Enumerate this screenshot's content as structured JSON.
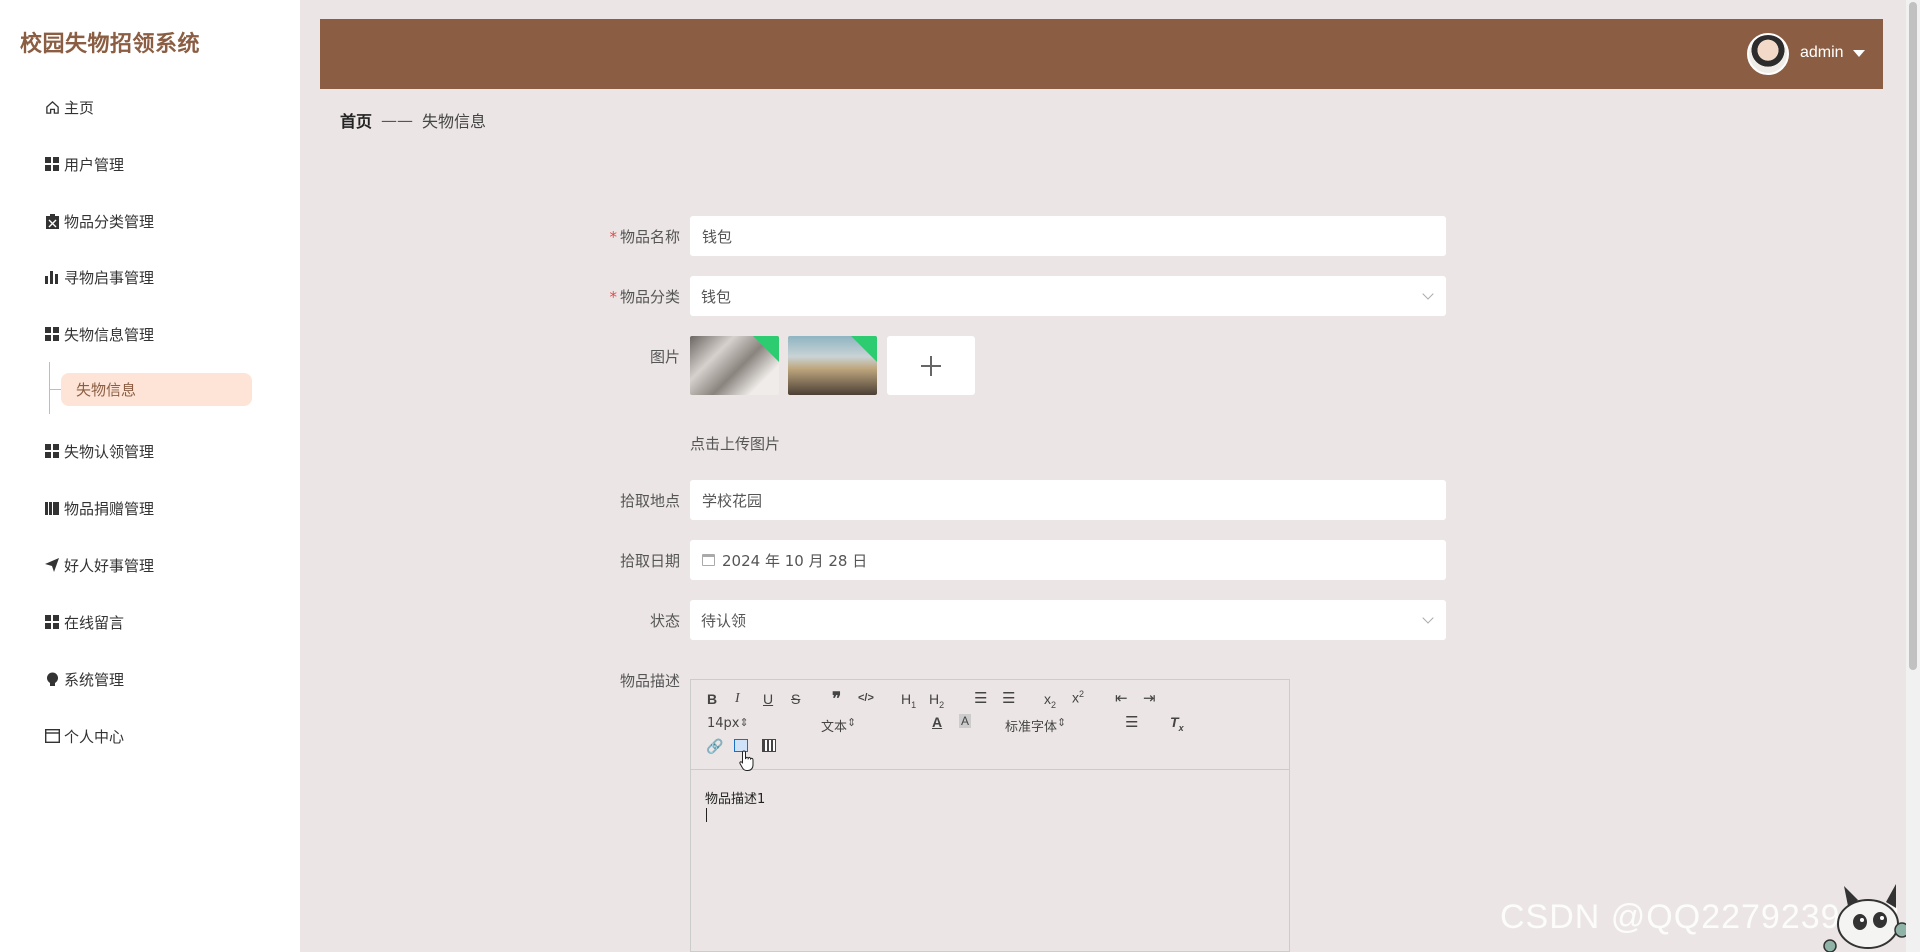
{
  "app_title": "校园失物招领系统",
  "menu": {
    "items": [
      {
        "label": "主页",
        "icon": "home-icon"
      },
      {
        "label": "用户管理",
        "icon": "grid-icon"
      },
      {
        "label": "物品分类管理",
        "icon": "clipboard-icon"
      },
      {
        "label": "寻物启事管理",
        "icon": "bar-chart-icon"
      },
      {
        "label": "失物信息管理",
        "icon": "grid-icon"
      },
      {
        "label": "失物认领管理",
        "icon": "grid-icon"
      },
      {
        "label": "物品捐赠管理",
        "icon": "book-icon"
      },
      {
        "label": "好人好事管理",
        "icon": "send-icon"
      },
      {
        "label": "在线留言",
        "icon": "grid-icon"
      },
      {
        "label": "系统管理",
        "icon": "bulb-icon"
      },
      {
        "label": "个人中心",
        "icon": "window-icon"
      }
    ],
    "active_sub_item": "失物信息"
  },
  "header": {
    "username": "admin"
  },
  "breadcrumb": {
    "home": "首页",
    "separator": "——",
    "current": "失物信息"
  },
  "form": {
    "item_name": {
      "label": "物品名称",
      "required": true,
      "value": "钱包"
    },
    "category": {
      "label": "物品分类",
      "required": true,
      "value": "钱包"
    },
    "images": {
      "label": "图片",
      "upload_hint": "点击上传图片",
      "count": 2
    },
    "location": {
      "label": "拾取地点",
      "value": "学校花园"
    },
    "date": {
      "label": "拾取日期",
      "value": "2024 年 10 月 28 日"
    },
    "status": {
      "label": "状态",
      "value": "待认领"
    },
    "description": {
      "label": "物品描述",
      "content": "物品描述1",
      "toolbar": {
        "font_size": "14px",
        "block_type": "文本",
        "font_family": "标准字体"
      }
    }
  },
  "watermark": "CSDN @QQ2279239102",
  "colors": {
    "brand": "#8b5e43",
    "background": "#ebe6e5",
    "active_submenu_bg": "#fde4d6",
    "required_star": "#e04b4b"
  }
}
